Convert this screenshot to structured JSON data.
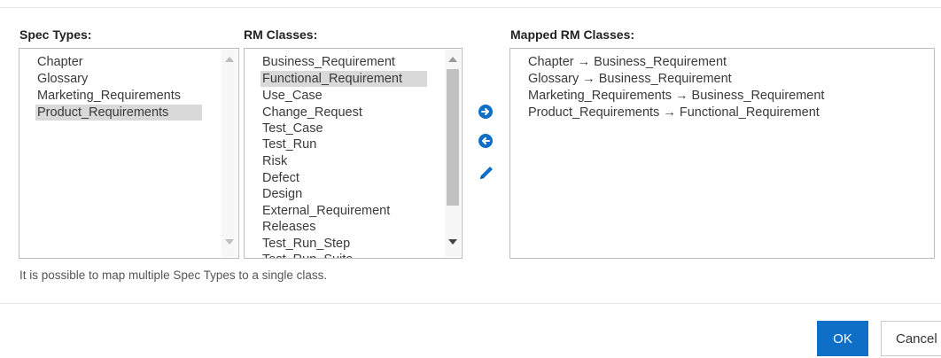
{
  "spec_types": {
    "label": "Spec Types:",
    "items": [
      "Chapter",
      "Glossary",
      "Marketing_Requirements",
      "Product_Requirements"
    ],
    "selected": "Product_Requirements"
  },
  "rm_classes": {
    "label": "RM Classes:",
    "items": [
      "Business_Requirement",
      "Functional_Requirement",
      "Use_Case",
      "Change_Request",
      "Test_Case",
      "Test_Run",
      "Risk",
      "Defect",
      "Design",
      "External_Requirement",
      "Releases",
      "Test_Run_Step",
      "Test_Run_Suite"
    ],
    "selected": "Functional_Requirement"
  },
  "mapped": {
    "label": "Mapped RM Classes:",
    "items": [
      "Chapter → Business_Requirement",
      "Glossary → Business_Requirement",
      "Marketing_Requirements → Business_Requirement",
      "Product_Requirements → Functional_Requirement"
    ]
  },
  "actions": {
    "add_icon": "arrow-right-circle-icon",
    "remove_icon": "arrow-left-circle-icon",
    "edit_icon": "pencil-icon"
  },
  "note": "It is possible to map multiple Spec Types to a single class.",
  "footer": {
    "ok_label": "OK",
    "cancel_label": "Cancel"
  },
  "colors": {
    "primary": "#0f6fc6",
    "selection": "#d9d9d9"
  }
}
